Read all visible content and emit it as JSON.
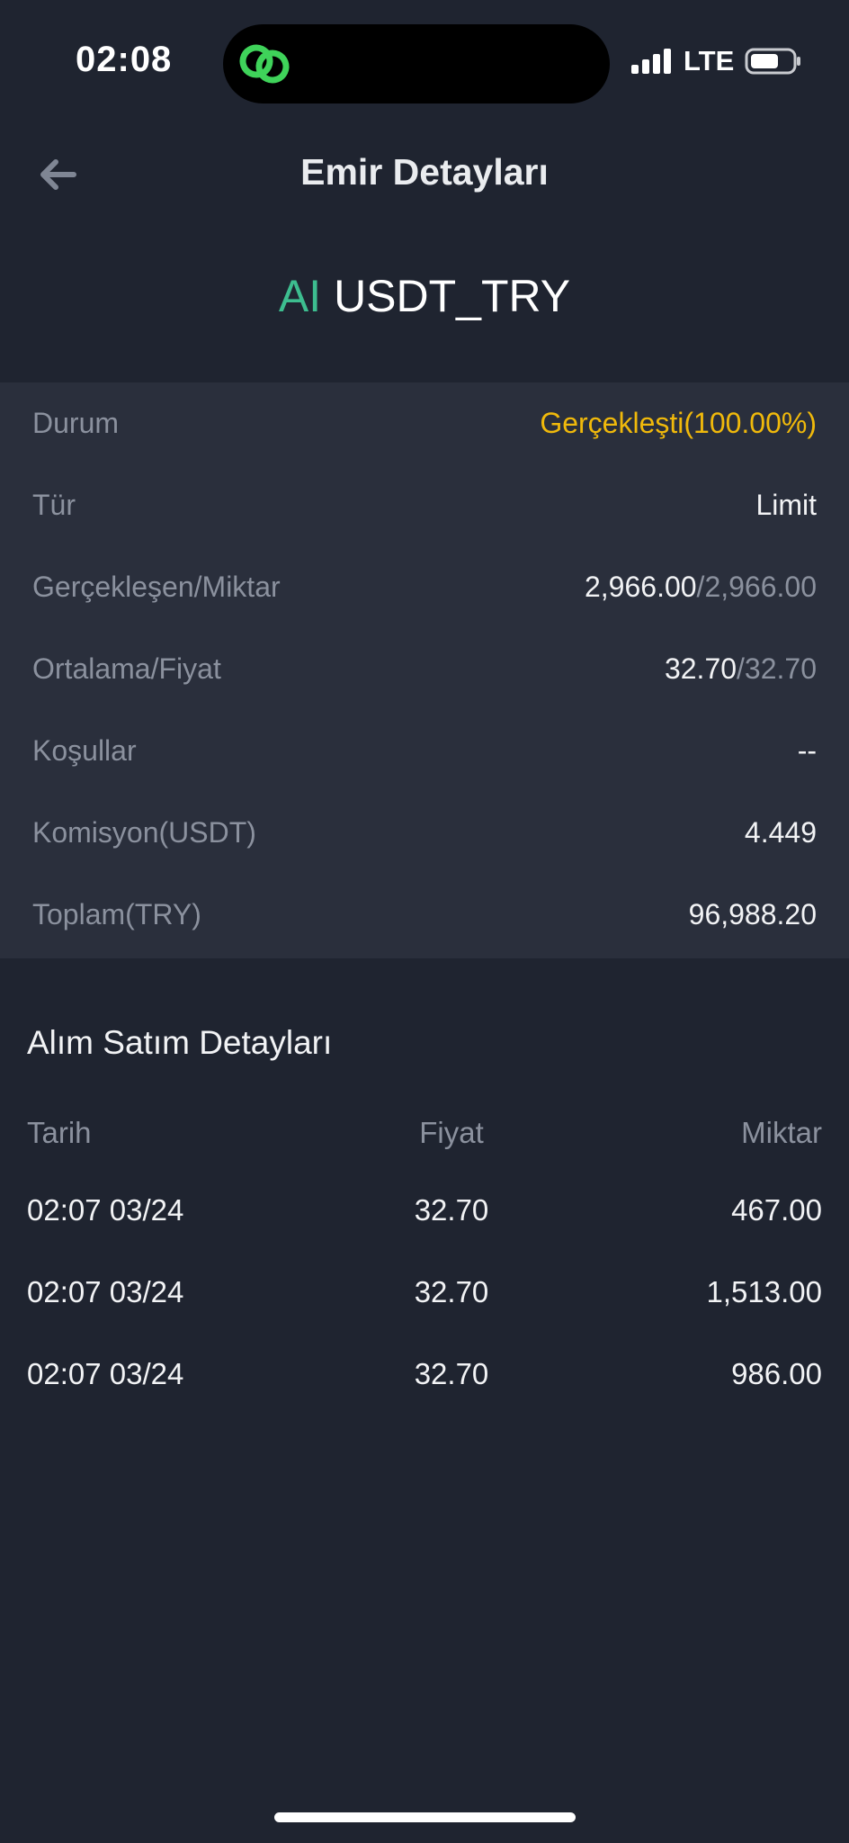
{
  "status_bar": {
    "time": "02:08",
    "network": "LTE"
  },
  "header": {
    "title": "Emir Detayları"
  },
  "pair": {
    "prefix": "AI",
    "symbol": "USDT_TRY"
  },
  "details": {
    "rows": [
      {
        "label": "Durum",
        "value": "Gerçekleşti(100.00%)"
      },
      {
        "label": "Tür",
        "value": "Limit"
      },
      {
        "label": "Gerçekleşen/Miktar",
        "value_main": "2,966.00",
        "value_secondary": "/2,966.00"
      },
      {
        "label": "Ortalama/Fiyat",
        "value_main": "32.70",
        "value_secondary": "/32.70"
      },
      {
        "label": "Koşullar",
        "value": "--"
      },
      {
        "label": "Komisyon(USDT)",
        "value": "4.449"
      },
      {
        "label": "Toplam(TRY)",
        "value": "96,988.20"
      }
    ]
  },
  "trades": {
    "title": "Alım Satım Detayları",
    "columns": [
      "Tarih",
      "Fiyat",
      "Miktar"
    ],
    "rows": [
      {
        "date": "02:07 03/24",
        "price": "32.70",
        "quantity": "467.00"
      },
      {
        "date": "02:07 03/24",
        "price": "32.70",
        "quantity": "1,513.00"
      },
      {
        "date": "02:07 03/24",
        "price": "32.70",
        "quantity": "986.00"
      }
    ]
  },
  "colors": {
    "background": "#1f2430",
    "panel": "#2a2f3c",
    "status_accent": "#f0b90b",
    "pair_prefix": "#3dbd8f",
    "label_muted": "#8b919e"
  },
  "icons": {
    "back": "arrow-left-icon",
    "island_app": "link-icon",
    "signal": "cellular-signal-icon",
    "battery": "battery-icon"
  }
}
